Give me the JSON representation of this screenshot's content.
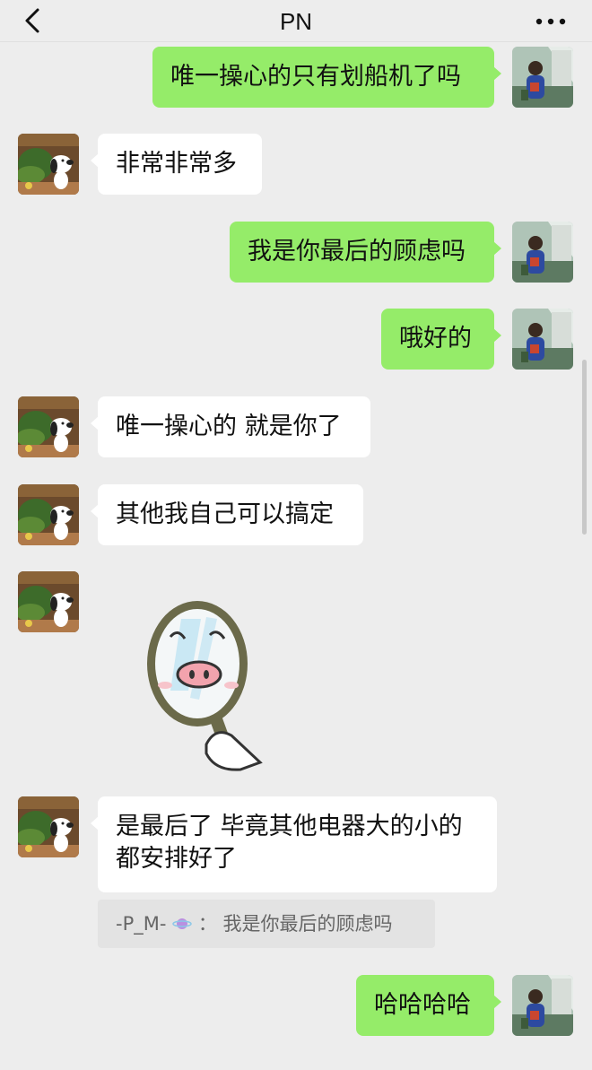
{
  "header": {
    "title": "PN"
  },
  "messages": [
    {
      "side": "out",
      "text": "唯一操心的只有划船机了吗"
    },
    {
      "side": "in",
      "text": "非常非常多"
    },
    {
      "side": "out",
      "text": "我是你最后的顾虑吗"
    },
    {
      "side": "out",
      "text": "哦好的"
    },
    {
      "side": "in",
      "text": "唯一操心的 就是你了"
    },
    {
      "side": "in",
      "text": "其他我自己可以搞定"
    },
    {
      "side": "in",
      "type": "sticker",
      "sticker": "pig-mirror-sticker"
    },
    {
      "side": "in",
      "line1": "是最后了 毕竟其他电器大的小的",
      "line2": "都安排好了",
      "quote": {
        "author": "-P_M-",
        "text": "我是你最后的顾虑吗"
      }
    },
    {
      "side": "out",
      "text": "哈哈哈哈"
    }
  ],
  "icons": {
    "back": "chevron-left-icon",
    "more": "more-dots-icon"
  },
  "colors": {
    "outgoing_bubble": "#95ec69",
    "incoming_bubble": "#ffffff",
    "background": "#ededed"
  }
}
